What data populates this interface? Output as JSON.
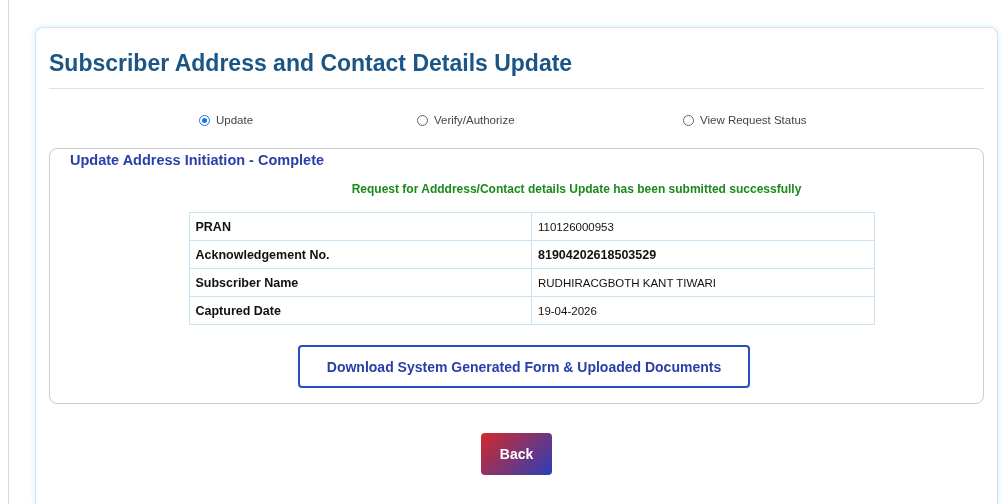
{
  "title": "Subscriber Address and Contact Details Update",
  "options": [
    {
      "label": "Update",
      "selected": true
    },
    {
      "label": "Verify/Authorize",
      "selected": false
    },
    {
      "label": "View Request Status",
      "selected": false
    }
  ],
  "panel": {
    "title": "Update Address Initiation - Complete",
    "message": "Request for Adddress/Contact details Update has been submitted successfully",
    "rows": [
      {
        "label": "PRAN",
        "value": "110126000953",
        "emphasis": false
      },
      {
        "label": "Acknowledgement No.",
        "value": "81904202618503529",
        "emphasis": true
      },
      {
        "label": "Subscriber Name",
        "value": "RUDHIRACGBOTH KANT TIWARI",
        "emphasis": false
      },
      {
        "label": "Captured Date",
        "value": "19-04-2026",
        "emphasis": false
      }
    ],
    "download_button": "Download System Generated Form & Uploaded Documents"
  },
  "back_button": "Back"
}
